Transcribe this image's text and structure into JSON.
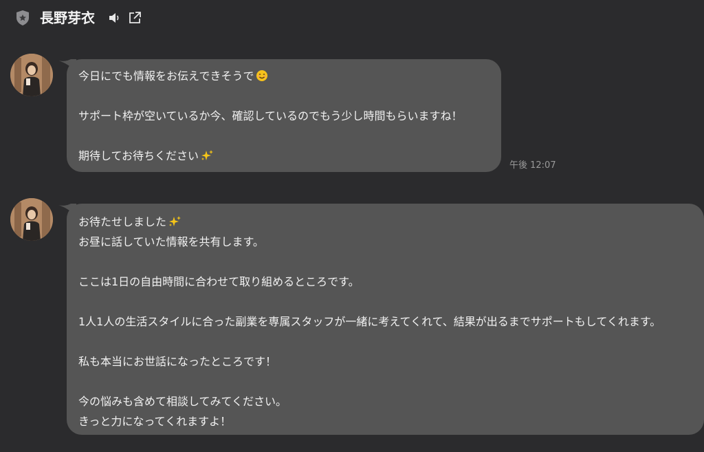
{
  "header": {
    "contact_name": "長野芽衣",
    "shield_icon": "shield-star-icon",
    "speaker_icon": "speaker-icon",
    "external_icon": "open-external-icon"
  },
  "messages": [
    {
      "lines": [
        "今日にでも情報をお伝えできそうで",
        "",
        "サポート枠が空いているか今、確認しているのでもう少し時間もらいますね！",
        "",
        "期待してお待ちください"
      ],
      "emoji_1": "smiling-face-emoji",
      "emoji_2": "sparkles-emoji",
      "time": "午後 12:07"
    },
    {
      "lines": [
        "お待たせしました",
        "お昼に話していた情報を共有します。",
        "",
        "ここは1日の自由時間に合わせて取り組めるところです。",
        "",
        "1人1人の生活スタイルに合った副業を専属スタッフが一緒に考えてくれて、結果が出るまでサポートもしてくれます。",
        "",
        "私も本当にお世話になったところです！",
        "",
        "今の悩みも含めて相談してみてください。",
        "きっと力になってくれますよ！"
      ],
      "emoji_1": "sparkles-emoji"
    }
  ],
  "colors": {
    "background": "#2b2b2d",
    "bubble": "#555555",
    "text": "#f1f1f1",
    "timestamp": "#9a9a9a"
  }
}
